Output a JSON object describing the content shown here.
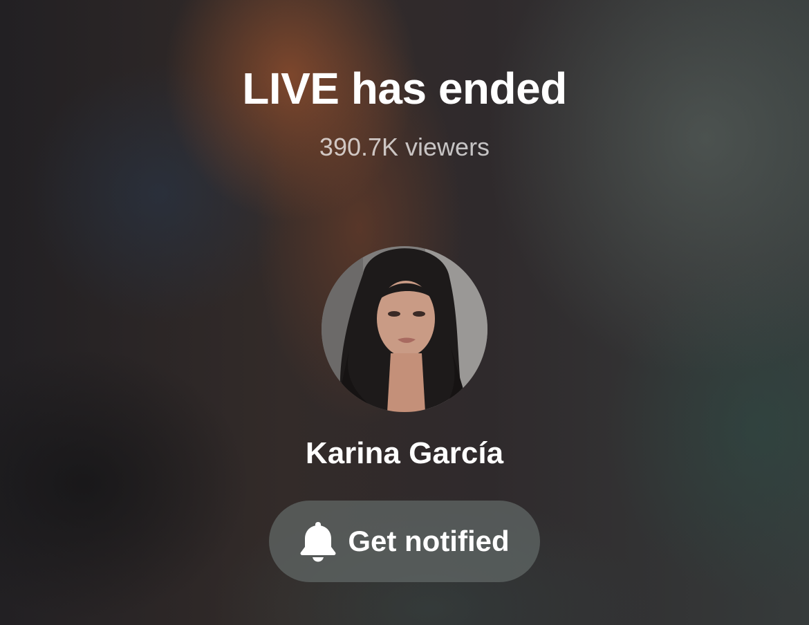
{
  "live_status": {
    "title": "LIVE has ended",
    "viewers": "390.7K viewers"
  },
  "host": {
    "name": "Karina García",
    "avatar_icon": "profile-photo"
  },
  "notify_button": {
    "label": "Get notified",
    "icon": "bell-icon"
  },
  "colors": {
    "text_primary": "#ffffff",
    "button_bg": "#626968"
  }
}
